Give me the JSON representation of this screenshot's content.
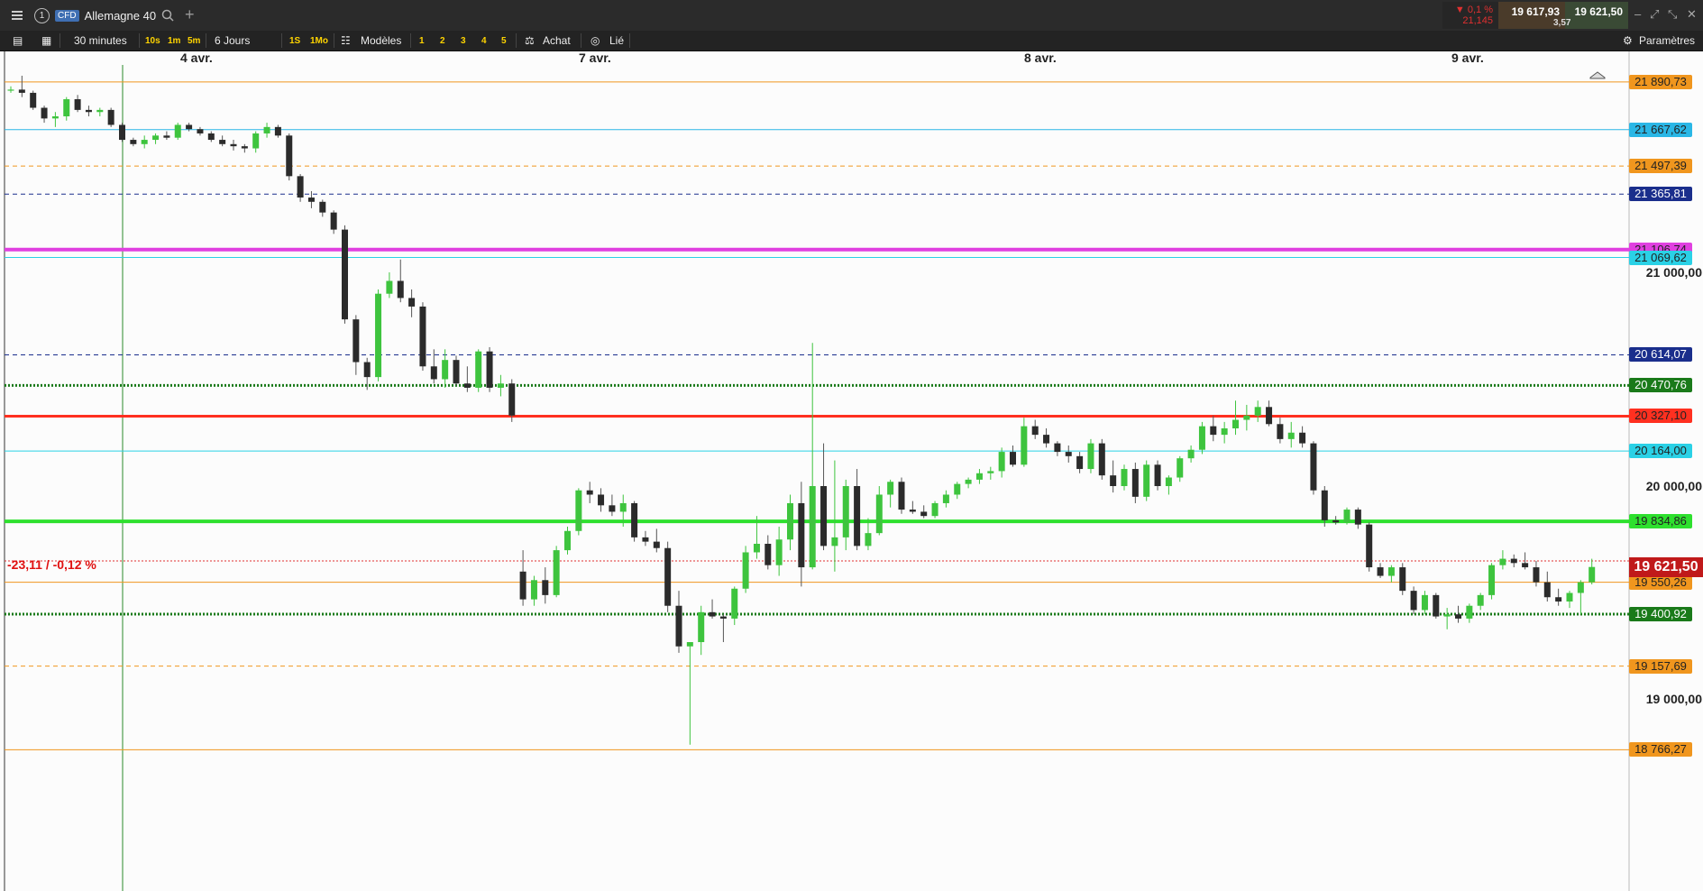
{
  "window": {
    "instrument_badge": "CFD",
    "instrument": "Allemagne 40",
    "change_pct": "▼ 0,1 %",
    "change_pts": "21,145",
    "sell_price": "19 617,93",
    "spread": "3,57",
    "buy_price": "19 621,50",
    "tab_number": "1"
  },
  "toolbar": {
    "timeframe": "30 minutes",
    "short_intervals": [
      "10s",
      "1m",
      "5m"
    ],
    "range": "6 Jours",
    "long_intervals": [
      "1S",
      "1Mo"
    ],
    "templates_label": "Modèles",
    "template_slots": [
      "1",
      "2",
      "3",
      "4",
      "5"
    ],
    "buy_label": "Achat",
    "linked_label": "Lié",
    "settings_label": "Paramètres"
  },
  "chart": {
    "dates": [
      {
        "label": "4 avr.",
        "x_candle": 6
      },
      {
        "label": "7 avr.",
        "x_candle": 37
      },
      {
        "label": "8 avr.",
        "x_candle": 67
      },
      {
        "label": "9 avr.",
        "x_candle": 96
      }
    ],
    "change_text": "-23,11 / -0,12 %",
    "current_price": "19 621,50",
    "axis_ticks": [
      "21 000,00",
      "20 000,00",
      "19 000,00"
    ],
    "levels": [
      {
        "label": "21 890,73",
        "value": 21890.73,
        "color": "#f0961e",
        "style": "solid",
        "width": 1
      },
      {
        "label": "21 667,62",
        "value": 21667.62,
        "color": "#2ab7e6",
        "style": "solid",
        "width": 1
      },
      {
        "label": "21 497,39",
        "value": 21497.39,
        "color": "#f0961e",
        "style": "dashed",
        "width": 1
      },
      {
        "label": "21 365,81",
        "value": 21365.81,
        "color": "#1a2e8c",
        "style": "dashed",
        "width": 1
      },
      {
        "label": "21 106,74",
        "value": 21106.74,
        "color": "#e040e0",
        "style": "solid",
        "width": 4
      },
      {
        "label": "21 069,62",
        "value": 21069.62,
        "color": "#2ad1e6",
        "style": "solid",
        "width": 1
      },
      {
        "label": "20 614,07",
        "value": 20614.07,
        "color": "#1a2e8c",
        "style": "dashed",
        "width": 1
      },
      {
        "label": "20 470,76",
        "value": 20470.76,
        "color": "#1a7a1a",
        "style": "dotted",
        "width": 3
      },
      {
        "label": "20 327,10",
        "value": 20327.1,
        "color": "#ff3020",
        "style": "solid",
        "width": 3
      },
      {
        "label": "20 164,00",
        "value": 20164.0,
        "color": "#2ad1e6",
        "style": "solid",
        "width": 1
      },
      {
        "label": "19 834,86",
        "value": 19834.86,
        "color": "#2ee02e",
        "style": "solid",
        "width": 4
      },
      {
        "label": "19 550,26",
        "value": 19550.26,
        "color": "#f0961e",
        "style": "solid",
        "width": 1
      },
      {
        "label": "19 400,92",
        "value": 19400.92,
        "color": "#1a7a1a",
        "style": "dotted",
        "width": 3
      },
      {
        "label": "19 157,69",
        "value": 19157.69,
        "color": "#f0961e",
        "style": "dashed",
        "width": 1
      },
      {
        "label": "18 766,27",
        "value": 18766.27,
        "color": "#f0961e",
        "style": "solid",
        "width": 1
      }
    ]
  },
  "chart_data": {
    "type": "candlestick",
    "title": "Allemagne 40 — 30 minutes",
    "ylim": [
      18150,
      22100
    ],
    "x": [
      "4 avr.",
      "7 avr.",
      "8 avr.",
      "9 avr."
    ],
    "series": [
      {
        "name": "Allemagne 40",
        "ohlc": [
          [
            21850,
            21870,
            21840,
            21855
          ],
          [
            21855,
            21920,
            21820,
            21840
          ],
          [
            21840,
            21850,
            21760,
            21770
          ],
          [
            21770,
            21780,
            21700,
            21720
          ],
          [
            21720,
            21750,
            21680,
            21730
          ],
          [
            21730,
            21820,
            21710,
            21810
          ],
          [
            21810,
            21830,
            21750,
            21760
          ],
          [
            21760,
            21780,
            21730,
            21750
          ],
          [
            21750,
            21770,
            21730,
            21760
          ],
          [
            21760,
            21770,
            21680,
            21690
          ],
          [
            21690,
            21700,
            21610,
            21620
          ],
          [
            21620,
            21630,
            21590,
            21600
          ],
          [
            21600,
            21640,
            21580,
            21620
          ],
          [
            21620,
            21650,
            21600,
            21640
          ],
          [
            21640,
            21660,
            21620,
            21630
          ],
          [
            21630,
            21700,
            21620,
            21690
          ],
          [
            21690,
            21700,
            21660,
            21670
          ],
          [
            21670,
            21680,
            21640,
            21650
          ],
          [
            21650,
            21660,
            21610,
            21620
          ],
          [
            21620,
            21640,
            21590,
            21600
          ],
          [
            21600,
            21620,
            21570,
            21590
          ],
          [
            21590,
            21600,
            21560,
            21580
          ],
          [
            21580,
            21660,
            21560,
            21650
          ],
          [
            21650,
            21700,
            21630,
            21680
          ],
          [
            21680,
            21690,
            21630,
            21640
          ],
          [
            21640,
            21650,
            21430,
            21450
          ],
          [
            21450,
            21460,
            21330,
            21350
          ],
          [
            21350,
            21380,
            21300,
            21330
          ],
          [
            21330,
            21340,
            21260,
            21280
          ],
          [
            21280,
            21290,
            21180,
            21200
          ],
          [
            21200,
            21220,
            20760,
            20780
          ],
          [
            20780,
            20800,
            20520,
            20580
          ],
          [
            20580,
            20600,
            20450,
            20510
          ],
          [
            20510,
            20920,
            20490,
            20900
          ],
          [
            20900,
            21000,
            20880,
            20960
          ],
          [
            20960,
            21060,
            20860,
            20880
          ],
          [
            20880,
            20920,
            20790,
            20840
          ],
          [
            20840,
            20860,
            20540,
            20560
          ],
          [
            20560,
            20640,
            20480,
            20500
          ],
          [
            20500,
            20640,
            20460,
            20590
          ],
          [
            20590,
            20610,
            20470,
            20480
          ],
          [
            20480,
            20560,
            20440,
            20460
          ],
          [
            20460,
            20640,
            20440,
            20630
          ],
          [
            20630,
            20650,
            20440,
            20460
          ],
          [
            20460,
            20520,
            20420,
            20480
          ],
          [
            20480,
            20500,
            20300,
            20330
          ],
          [
            19600,
            19700,
            19440,
            19470
          ],
          [
            19470,
            19580,
            19440,
            19560
          ],
          [
            19560,
            19620,
            19450,
            19490
          ],
          [
            19490,
            19720,
            19480,
            19700
          ],
          [
            19700,
            19810,
            19680,
            19790
          ],
          [
            19790,
            19990,
            19770,
            19980
          ],
          [
            19980,
            20020,
            19920,
            19960
          ],
          [
            19960,
            19990,
            19880,
            19910
          ],
          [
            19910,
            19960,
            19860,
            19880
          ],
          [
            19880,
            19960,
            19810,
            19920
          ],
          [
            19920,
            19930,
            19740,
            19760
          ],
          [
            19760,
            19790,
            19720,
            19740
          ],
          [
            19740,
            19800,
            19690,
            19710
          ],
          [
            19710,
            19740,
            19410,
            19440
          ],
          [
            19440,
            19510,
            19220,
            19250
          ],
          [
            19250,
            19260,
            18790,
            19270
          ],
          [
            19270,
            19440,
            19210,
            19410
          ],
          [
            19410,
            19470,
            19380,
            19390
          ],
          [
            19390,
            19400,
            19270,
            19380
          ],
          [
            19380,
            19530,
            19350,
            19520
          ],
          [
            19520,
            19720,
            19500,
            19690
          ],
          [
            19690,
            19860,
            19660,
            19730
          ],
          [
            19730,
            19770,
            19610,
            19630
          ],
          [
            19630,
            19810,
            19580,
            19750
          ],
          [
            19750,
            19960,
            19700,
            19920
          ],
          [
            19920,
            20020,
            19530,
            19620
          ],
          [
            19620,
            20670,
            19610,
            20000
          ],
          [
            20000,
            20200,
            19700,
            19720
          ],
          [
            19720,
            20120,
            19600,
            19760
          ],
          [
            19760,
            20030,
            19700,
            20000
          ],
          [
            20000,
            20080,
            19700,
            19720
          ],
          [
            19720,
            19850,
            19700,
            19780
          ],
          [
            19780,
            20000,
            19770,
            19960
          ],
          [
            19960,
            20030,
            19900,
            20020
          ],
          [
            20020,
            20040,
            19870,
            19890
          ],
          [
            19890,
            19930,
            19870,
            19880
          ],
          [
            19880,
            19910,
            19850,
            19860
          ],
          [
            19860,
            19930,
            19850,
            19920
          ],
          [
            19920,
            19980,
            19900,
            19960
          ],
          [
            19960,
            20020,
            19940,
            20010
          ],
          [
            20010,
            20040,
            19990,
            20030
          ],
          [
            20030,
            20080,
            20010,
            20060
          ],
          [
            20060,
            20090,
            20030,
            20070
          ],
          [
            20070,
            20180,
            20040,
            20160
          ],
          [
            20160,
            20190,
            20090,
            20100
          ],
          [
            20100,
            20320,
            20090,
            20280
          ],
          [
            20280,
            20310,
            20220,
            20240
          ],
          [
            20240,
            20270,
            20180,
            20200
          ],
          [
            20200,
            20210,
            20140,
            20160
          ],
          [
            20160,
            20190,
            20110,
            20140
          ],
          [
            20140,
            20160,
            20060,
            20080
          ],
          [
            20080,
            20220,
            20060,
            20200
          ],
          [
            20200,
            20220,
            20030,
            20050
          ],
          [
            20050,
            20120,
            19970,
            20000
          ],
          [
            20000,
            20100,
            19980,
            20080
          ],
          [
            20080,
            20110,
            19920,
            19950
          ],
          [
            19950,
            20120,
            19930,
            20100
          ],
          [
            20100,
            20120,
            19980,
            20000
          ],
          [
            20000,
            20050,
            19960,
            20040
          ],
          [
            20040,
            20140,
            20020,
            20130
          ],
          [
            20130,
            20190,
            20110,
            20170
          ],
          [
            20170,
            20300,
            20150,
            20280
          ],
          [
            20280,
            20330,
            20210,
            20240
          ],
          [
            20240,
            20300,
            20200,
            20270
          ],
          [
            20270,
            20400,
            20240,
            20310
          ],
          [
            20310,
            20380,
            20260,
            20330
          ],
          [
            20330,
            20400,
            20300,
            20370
          ],
          [
            20370,
            20400,
            20280,
            20290
          ],
          [
            20290,
            20320,
            20200,
            20220
          ],
          [
            20220,
            20300,
            20180,
            20250
          ],
          [
            20250,
            20280,
            20180,
            20200
          ],
          [
            20200,
            20210,
            19960,
            19980
          ],
          [
            19980,
            20000,
            19810,
            19840
          ],
          [
            19840,
            19860,
            19820,
            19830
          ],
          [
            19830,
            19900,
            19820,
            19890
          ],
          [
            19890,
            19900,
            19800,
            19820
          ],
          [
            19820,
            19830,
            19600,
            19620
          ],
          [
            19620,
            19640,
            19570,
            19580
          ],
          [
            19580,
            19630,
            19550,
            19620
          ],
          [
            19620,
            19640,
            19490,
            19510
          ],
          [
            19510,
            19530,
            19400,
            19420
          ],
          [
            19420,
            19510,
            19400,
            19490
          ],
          [
            19490,
            19500,
            19380,
            19390
          ],
          [
            19390,
            19430,
            19330,
            19400
          ],
          [
            19400,
            19440,
            19360,
            19380
          ],
          [
            19380,
            19450,
            19360,
            19440
          ],
          [
            19440,
            19500,
            19420,
            19490
          ],
          [
            19490,
            19640,
            19470,
            19630
          ],
          [
            19630,
            19700,
            19610,
            19660
          ],
          [
            19660,
            19680,
            19620,
            19640
          ],
          [
            19640,
            19690,
            19610,
            19620
          ],
          [
            19620,
            19650,
            19530,
            19550
          ],
          [
            19550,
            19600,
            19460,
            19480
          ],
          [
            19480,
            19520,
            19440,
            19460
          ],
          [
            19460,
            19510,
            19430,
            19500
          ],
          [
            19500,
            19560,
            19400,
            19550
          ],
          [
            19550,
            19660,
            19540,
            19621.5
          ]
        ]
      }
    ]
  }
}
